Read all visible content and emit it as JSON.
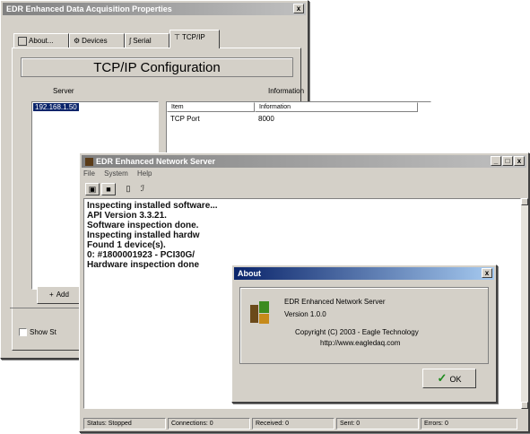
{
  "props": {
    "title": "EDR Enhanced Data Acquisition Properties",
    "close": "x",
    "tabs": [
      "About...",
      "Devices",
      "Serial",
      "TCP/IP"
    ],
    "config_title": "TCP/IP Configuration",
    "server_label": "Server",
    "info_label": "Information",
    "server_item": "192.168.1.50",
    "table": {
      "headers": [
        "Item",
        "Information"
      ],
      "rows": [
        [
          "TCP Port",
          "8000"
        ]
      ]
    },
    "add_button": "Add",
    "show_label": "Show St"
  },
  "server": {
    "title": "EDR Enhanced Network Server",
    "menu": [
      "File",
      "System",
      "Help"
    ],
    "controls": [
      "_",
      "□",
      "x"
    ],
    "log": [
      "Inspecting installed software...",
      "API Version 3.3.21.",
      "Software inspection done.",
      "Inspecting installed hardw",
      "Found 1 device(s).",
      "0: #1800001923 - PCI30G/",
      "Hardware inspection done"
    ],
    "status": [
      "Status: Stopped",
      "Connections: 0",
      "Received: 0",
      "Sent: 0",
      "Errors: 0"
    ]
  },
  "about": {
    "title": "About",
    "close": "x",
    "product": "EDR Enhanced Network Server",
    "version": "Version 1.0.0",
    "copyright": "Copyright (C) 2003 - Eagle Technology",
    "url": "http://www.eagledaq.com",
    "ok": "OK"
  }
}
